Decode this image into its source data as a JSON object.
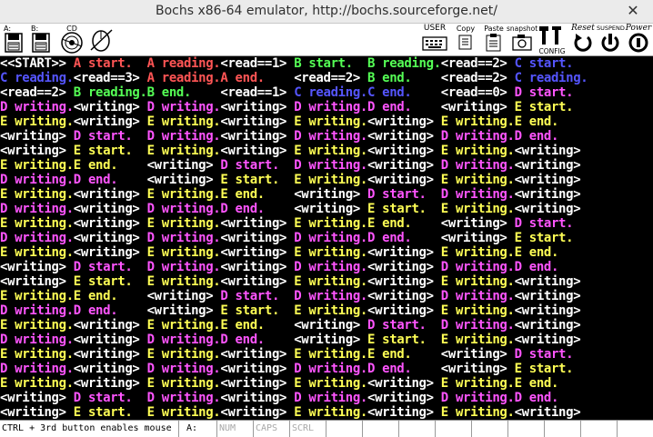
{
  "window": {
    "title": "Bochs x86-64 emulator, http://bochs.sourceforge.net/",
    "close_glyph": "✕"
  },
  "toolbar": {
    "floppy_a": "A:",
    "floppy_b": "B:",
    "cdrom": "CD",
    "user": "USER",
    "copy": "Copy",
    "paste": "Paste",
    "snapshot": "snapshot",
    "config": "CONFIG",
    "reset": "Reset",
    "suspend": "SUSPEND",
    "power": "Power"
  },
  "colors": {
    "default": "#ffffff",
    "A": "#ff5555",
    "B": "#55ff55",
    "C": "#5555ff",
    "D": "#ff55ff",
    "E": "#ffff55"
  },
  "console": {
    "lines": [
      [
        [
          "w",
          "<<START>> "
        ],
        [
          "A",
          "A start.  "
        ],
        [
          "A",
          "A reading."
        ],
        [
          "w",
          "<read==1> "
        ],
        [
          "B",
          "B start.  "
        ],
        [
          "B",
          "B reading."
        ],
        [
          "w",
          "<read==2> "
        ],
        [
          "C",
          "C start.  "
        ]
      ],
      [
        [
          "C",
          "C reading."
        ],
        [
          "w",
          "<read==3> "
        ],
        [
          "A",
          "A reading."
        ],
        [
          "A",
          "A end.    "
        ],
        [
          "w",
          "<read==2> "
        ],
        [
          "B",
          "B end.    "
        ],
        [
          "w",
          "<read==2> "
        ],
        [
          "C",
          "C reading."
        ]
      ],
      [
        [
          "w",
          "<read==2> "
        ],
        [
          "B",
          "B reading."
        ],
        [
          "B",
          "B end.    "
        ],
        [
          "w",
          "<read==1> "
        ],
        [
          "C",
          "C reading."
        ],
        [
          "C",
          "C end.    "
        ],
        [
          "w",
          "<read==0> "
        ],
        [
          "D",
          "D start.  "
        ]
      ],
      [
        [
          "D",
          "D writing."
        ],
        [
          "w",
          "<writing> "
        ],
        [
          "D",
          "D writing."
        ],
        [
          "w",
          "<writing> "
        ],
        [
          "D",
          "D writing."
        ],
        [
          "D",
          "D end.    "
        ],
        [
          "w",
          "<writing> "
        ],
        [
          "E",
          "E start.  "
        ]
      ],
      [
        [
          "E",
          "E writing."
        ],
        [
          "w",
          "<writing> "
        ],
        [
          "E",
          "E writing."
        ],
        [
          "w",
          "<writing> "
        ],
        [
          "E",
          "E writing."
        ],
        [
          "w",
          "<writing> "
        ],
        [
          "E",
          "E writing."
        ],
        [
          "E",
          "E end.    "
        ]
      ],
      [
        [
          "w",
          "<writing> "
        ],
        [
          "D",
          "D start.  "
        ],
        [
          "D",
          "D writing."
        ],
        [
          "w",
          "<writing> "
        ],
        [
          "D",
          "D writing."
        ],
        [
          "w",
          "<writing> "
        ],
        [
          "D",
          "D writing."
        ],
        [
          "D",
          "D end.    "
        ]
      ],
      [
        [
          "w",
          "<writing> "
        ],
        [
          "E",
          "E start.  "
        ],
        [
          "E",
          "E writing."
        ],
        [
          "w",
          "<writing> "
        ],
        [
          "E",
          "E writing."
        ],
        [
          "w",
          "<writing> "
        ],
        [
          "E",
          "E writing."
        ],
        [
          "w",
          "<writing> "
        ]
      ],
      [
        [
          "E",
          "E writing."
        ],
        [
          "E",
          "E end.    "
        ],
        [
          "w",
          "<writing> "
        ],
        [
          "D",
          "D start.  "
        ],
        [
          "D",
          "D writing."
        ],
        [
          "w",
          "<writing> "
        ],
        [
          "D",
          "D writing."
        ],
        [
          "w",
          "<writing> "
        ]
      ],
      [
        [
          "D",
          "D writing."
        ],
        [
          "D",
          "D end.    "
        ],
        [
          "w",
          "<writing> "
        ],
        [
          "E",
          "E start.  "
        ],
        [
          "E",
          "E writing."
        ],
        [
          "w",
          "<writing> "
        ],
        [
          "E",
          "E writing."
        ],
        [
          "w",
          "<writing> "
        ]
      ],
      [
        [
          "E",
          "E writing."
        ],
        [
          "w",
          "<writing> "
        ],
        [
          "E",
          "E writing."
        ],
        [
          "E",
          "E end.    "
        ],
        [
          "w",
          "<writing> "
        ],
        [
          "D",
          "D start.  "
        ],
        [
          "D",
          "D writing."
        ],
        [
          "w",
          "<writing> "
        ]
      ],
      [
        [
          "D",
          "D writing."
        ],
        [
          "w",
          "<writing> "
        ],
        [
          "D",
          "D writing."
        ],
        [
          "D",
          "D end.    "
        ],
        [
          "w",
          "<writing> "
        ],
        [
          "E",
          "E start.  "
        ],
        [
          "E",
          "E writing."
        ],
        [
          "w",
          "<writing> "
        ]
      ],
      [
        [
          "E",
          "E writing."
        ],
        [
          "w",
          "<writing> "
        ],
        [
          "E",
          "E writing."
        ],
        [
          "w",
          "<writing> "
        ],
        [
          "E",
          "E writing."
        ],
        [
          "E",
          "E end.    "
        ],
        [
          "w",
          "<writing> "
        ],
        [
          "D",
          "D start.  "
        ]
      ],
      [
        [
          "D",
          "D writing."
        ],
        [
          "w",
          "<writing> "
        ],
        [
          "D",
          "D writing."
        ],
        [
          "w",
          "<writing> "
        ],
        [
          "D",
          "D writing."
        ],
        [
          "D",
          "D end.    "
        ],
        [
          "w",
          "<writing> "
        ],
        [
          "E",
          "E start.  "
        ]
      ],
      [
        [
          "E",
          "E writing."
        ],
        [
          "w",
          "<writing> "
        ],
        [
          "E",
          "E writing."
        ],
        [
          "w",
          "<writing> "
        ],
        [
          "E",
          "E writing."
        ],
        [
          "w",
          "<writing> "
        ],
        [
          "E",
          "E writing."
        ],
        [
          "E",
          "E end.    "
        ]
      ],
      [
        [
          "w",
          "<writing> "
        ],
        [
          "D",
          "D start.  "
        ],
        [
          "D",
          "D writing."
        ],
        [
          "w",
          "<writing> "
        ],
        [
          "D",
          "D writing."
        ],
        [
          "w",
          "<writing> "
        ],
        [
          "D",
          "D writing."
        ],
        [
          "D",
          "D end.    "
        ]
      ],
      [
        [
          "w",
          "<writing> "
        ],
        [
          "E",
          "E start.  "
        ],
        [
          "E",
          "E writing."
        ],
        [
          "w",
          "<writing> "
        ],
        [
          "E",
          "E writing."
        ],
        [
          "w",
          "<writing> "
        ],
        [
          "E",
          "E writing."
        ],
        [
          "w",
          "<writing> "
        ]
      ],
      [
        [
          "E",
          "E writing."
        ],
        [
          "E",
          "E end.    "
        ],
        [
          "w",
          "<writing> "
        ],
        [
          "D",
          "D start.  "
        ],
        [
          "D",
          "D writing."
        ],
        [
          "w",
          "<writing> "
        ],
        [
          "D",
          "D writing."
        ],
        [
          "w",
          "<writing> "
        ]
      ],
      [
        [
          "D",
          "D writing."
        ],
        [
          "D",
          "D end.    "
        ],
        [
          "w",
          "<writing> "
        ],
        [
          "E",
          "E start.  "
        ],
        [
          "E",
          "E writing."
        ],
        [
          "w",
          "<writing> "
        ],
        [
          "E",
          "E writing."
        ],
        [
          "w",
          "<writing> "
        ]
      ],
      [
        [
          "E",
          "E writing."
        ],
        [
          "w",
          "<writing> "
        ],
        [
          "E",
          "E writing."
        ],
        [
          "E",
          "E end.    "
        ],
        [
          "w",
          "<writing> "
        ],
        [
          "D",
          "D start.  "
        ],
        [
          "D",
          "D writing."
        ],
        [
          "w",
          "<writing> "
        ]
      ],
      [
        [
          "D",
          "D writing."
        ],
        [
          "w",
          "<writing> "
        ],
        [
          "D",
          "D writing."
        ],
        [
          "D",
          "D end.    "
        ],
        [
          "w",
          "<writing> "
        ],
        [
          "E",
          "E start.  "
        ],
        [
          "E",
          "E writing."
        ],
        [
          "w",
          "<writing> "
        ]
      ],
      [
        [
          "E",
          "E writing."
        ],
        [
          "w",
          "<writing> "
        ],
        [
          "E",
          "E writing."
        ],
        [
          "w",
          "<writing> "
        ],
        [
          "E",
          "E writing."
        ],
        [
          "E",
          "E end.    "
        ],
        [
          "w",
          "<writing> "
        ],
        [
          "D",
          "D start.  "
        ]
      ],
      [
        [
          "D",
          "D writing."
        ],
        [
          "w",
          "<writing> "
        ],
        [
          "D",
          "D writing."
        ],
        [
          "w",
          "<writing> "
        ],
        [
          "D",
          "D writing."
        ],
        [
          "D",
          "D end.    "
        ],
        [
          "w",
          "<writing> "
        ],
        [
          "E",
          "E start.  "
        ]
      ],
      [
        [
          "E",
          "E writing."
        ],
        [
          "w",
          "<writing> "
        ],
        [
          "E",
          "E writing."
        ],
        [
          "w",
          "<writing> "
        ],
        [
          "E",
          "E writing."
        ],
        [
          "w",
          "<writing> "
        ],
        [
          "E",
          "E writing."
        ],
        [
          "E",
          "E end.    "
        ]
      ],
      [
        [
          "w",
          "<writing> "
        ],
        [
          "D",
          "D start.  "
        ],
        [
          "D",
          "D writing."
        ],
        [
          "w",
          "<writing> "
        ],
        [
          "D",
          "D writing."
        ],
        [
          "w",
          "<writing> "
        ],
        [
          "D",
          "D writing."
        ],
        [
          "D",
          "D end.    "
        ]
      ],
      [
        [
          "w",
          "<writing> "
        ],
        [
          "E",
          "E start.  "
        ],
        [
          "E",
          "E writing."
        ],
        [
          "w",
          "<writing> "
        ],
        [
          "E",
          "E writing."
        ],
        [
          "w",
          "<writing> "
        ],
        [
          "E",
          "E writing."
        ],
        [
          "w",
          "<writing> "
        ]
      ]
    ]
  },
  "statusbar": {
    "message": "CTRL + 3rd button enables mouse",
    "drive": "A:",
    "num": "NUM",
    "caps": "CAPS",
    "scrl": "SCRL"
  }
}
